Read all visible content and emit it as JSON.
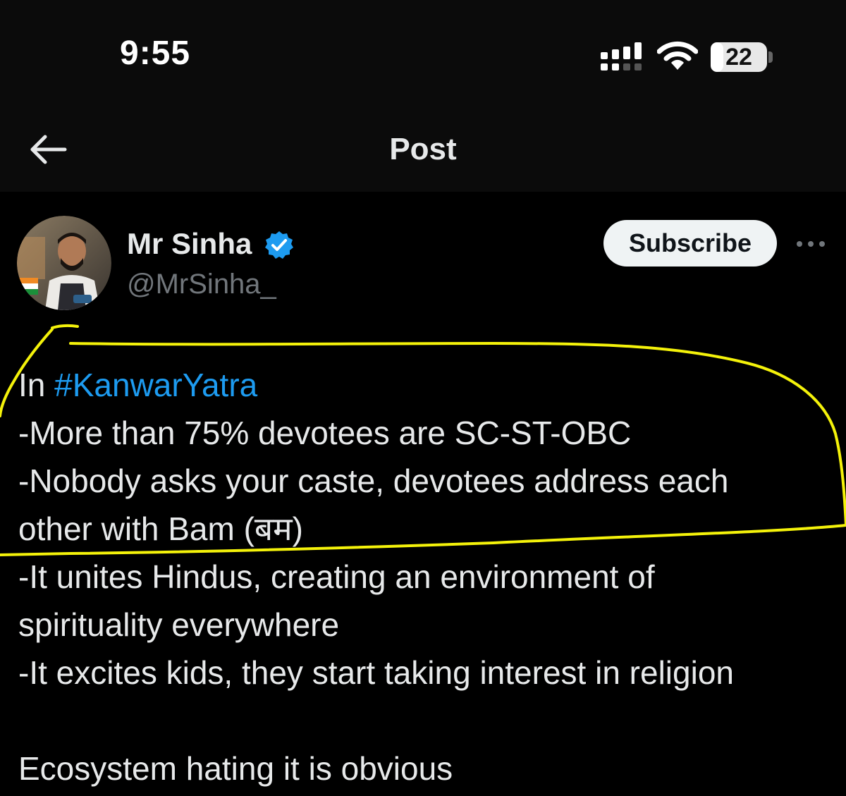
{
  "status_bar": {
    "time": "9:55",
    "battery_percent": "22",
    "battery_level": 0.22,
    "icons": [
      "signal-icon",
      "wifi-icon",
      "battery-icon"
    ]
  },
  "header": {
    "title": "Post",
    "back_icon": "arrow-left-icon"
  },
  "author": {
    "name": "Mr Sinha",
    "handle": "@MrSinha_",
    "verified": true,
    "verified_color": "#1d9bf0"
  },
  "actions": {
    "subscribe_label": "Subscribe",
    "more_icon": "more-horizontal-icon"
  },
  "post": {
    "line1_prefix": "In ",
    "hashtag": "#KanwarYatra",
    "line2": "-More than 75% devotees are SC-ST-OBC",
    "line3": "-Nobody asks your caste, devotees address each",
    "line4": "other with Bam (बम)",
    "line5": "-It unites Hindus, creating an environment of",
    "line6": "spirituality everywhere",
    "line7": "-It excites kids, they start taking interest in religion",
    "line8": "Ecosystem hating it is obvious"
  },
  "annotation": {
    "type": "hand-drawn highlight outline",
    "color": "#f4f20a"
  },
  "colors": {
    "background": "#000000",
    "text": "#e7e9ea",
    "secondary_text": "#71767b",
    "link": "#1d9bf0"
  }
}
